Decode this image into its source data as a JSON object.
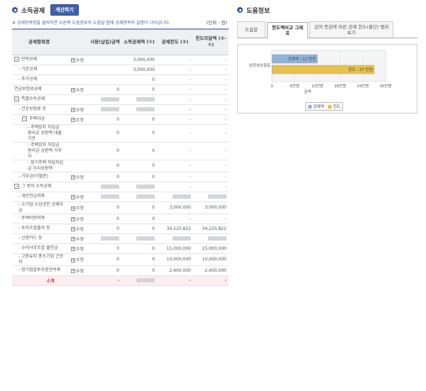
{
  "deduction": {
    "title": "소득공제",
    "calc_button": "계산하기",
    "notice": "※ 공제항목명을 클릭하면 오른쪽 도움정보의 도움말 탭에 공제항목의 설명이 나타납니다.",
    "unit": "(단위 : 원)",
    "columns": [
      "공제항목명",
      "",
      "사용(납입)금액",
      "소득공제액 (①)",
      "공제한도 (②)",
      "한도미달액 (②-①)"
    ],
    "edit_label": "수정",
    "rows": [
      {
        "label": "인적공제",
        "toggle": "−",
        "indent": 0,
        "edit": true,
        "used": "",
        "deduct": "3,000,000",
        "limit": "-",
        "short": "-"
      },
      {
        "label": "- 기본공제",
        "indent": 1,
        "edit": false,
        "used": "",
        "deduct": "3,000,000",
        "limit": "-",
        "short": "-"
      },
      {
        "label": "- 추가공제",
        "indent": 1,
        "edit": false,
        "used": "",
        "deduct": "0",
        "limit": "-",
        "short": "-"
      },
      {
        "label": "연금보험료공제",
        "indent": 0,
        "edit": true,
        "used": "0",
        "deduct": "0",
        "limit": "-",
        "short": "-"
      },
      {
        "label": "특별소득공제",
        "toggle": "−",
        "indent": 0,
        "edit": false,
        "used": "blur",
        "deduct": "blur",
        "limit": "-",
        "short": "-"
      },
      {
        "label": "- 건강보험료 등",
        "indent": 1,
        "edit": true,
        "used": "blur",
        "deduct": "blur",
        "limit": "-",
        "short": "-"
      },
      {
        "label": "주택자금",
        "toggle": "−",
        "indent": 2,
        "edit": true,
        "used": "0",
        "deduct": "0",
        "limit": "-",
        "short": "-"
      },
      {
        "label": "- 주택임차 차입금 원리금 상환액 대출기관",
        "indent": 3,
        "edit": false,
        "used": "0",
        "deduct": "0",
        "limit": "-",
        "short": "-"
      },
      {
        "label": "- 주택임차 차입금 원리금 상환액 거주자",
        "indent": 3,
        "edit": false,
        "used": "0",
        "deduct": "0",
        "limit": "-",
        "short": "-"
      },
      {
        "label": "- 장기주택 저당차입금 이자상환액",
        "indent": 3,
        "edit": false,
        "used": "0",
        "deduct": "0",
        "limit": "-",
        "short": "-"
      },
      {
        "label": "- 기부금(이월분)",
        "indent": 1,
        "edit": true,
        "used": "0",
        "deduct": "0",
        "limit": "-",
        "short": "-"
      },
      {
        "label": "그 밖의 소득공제",
        "toggle": "−",
        "indent": 0,
        "edit": false,
        "used": "blur",
        "deduct": "blur",
        "limit": "-",
        "short": "-"
      },
      {
        "label": "- 개인연금저축",
        "indent": 1,
        "edit": true,
        "used": "blur",
        "deduct": "blur",
        "limit": "blur",
        "short": "blur"
      },
      {
        "label": "- 소기업·소상공인 공제부금",
        "indent": 1,
        "edit": true,
        "used": "0",
        "deduct": "0",
        "limit": "3,000,000",
        "short": "3,000,000"
      },
      {
        "label": "- 주택마련저축",
        "indent": 1,
        "edit": true,
        "used": "0",
        "deduct": "0",
        "limit": "-",
        "short": "-"
      },
      {
        "label": "- 투자조합출자 등",
        "indent": 1,
        "edit": true,
        "used": "0",
        "deduct": "0",
        "limit": "34,225,822",
        "short": "34,225,822"
      },
      {
        "label": "- 신용카드 등",
        "indent": 1,
        "edit": true,
        "used": "blur",
        "deduct": "blur",
        "limit": "blur",
        "short": "blur"
      },
      {
        "label": "- 우리사주조합 출연금",
        "indent": 1,
        "edit": true,
        "used": "0",
        "deduct": "0",
        "limit": "15,000,000",
        "short": "15,000,000"
      },
      {
        "label": "- 고용유지 중소기업 근로자",
        "indent": 1,
        "edit": true,
        "used": "0",
        "deduct": "0",
        "limit": "10,000,000",
        "short": "10,000,000"
      },
      {
        "label": "- 장기집합투자증권저축",
        "indent": 1,
        "edit": true,
        "used": "0",
        "deduct": "0",
        "limit": "2,400,000",
        "short": "2,400,000"
      }
    ],
    "total": {
      "label": "소계",
      "used": "-",
      "deduct": "blur",
      "limit": "-",
      "short": "-"
    }
  },
  "help": {
    "title": "도움정보",
    "tabs": [
      "도움말",
      "한도액비교 그래프",
      "급여 증감에 따른 공제 한도(율단) 범위 보기"
    ],
    "active_tab": 1
  },
  "chart_data": {
    "type": "bar",
    "orientation": "horizontal",
    "categories": [
      "보장성보험료"
    ],
    "series": [
      {
        "name": "공제액",
        "values": [
          12
        ],
        "color": "#8fb3d9"
      },
      {
        "name": "한도",
        "values": [
          27
        ],
        "color": "#e5c24a"
      }
    ],
    "data_labels": [
      "공제액 : 12 만원",
      "한도 : 27 만원"
    ],
    "x_ticks": [
      "0",
      "6만원",
      "12만원",
      "18만원",
      "24만원",
      "30만원"
    ],
    "xlim": [
      0,
      30
    ],
    "xlabel": "금액",
    "legend": "bottom"
  }
}
